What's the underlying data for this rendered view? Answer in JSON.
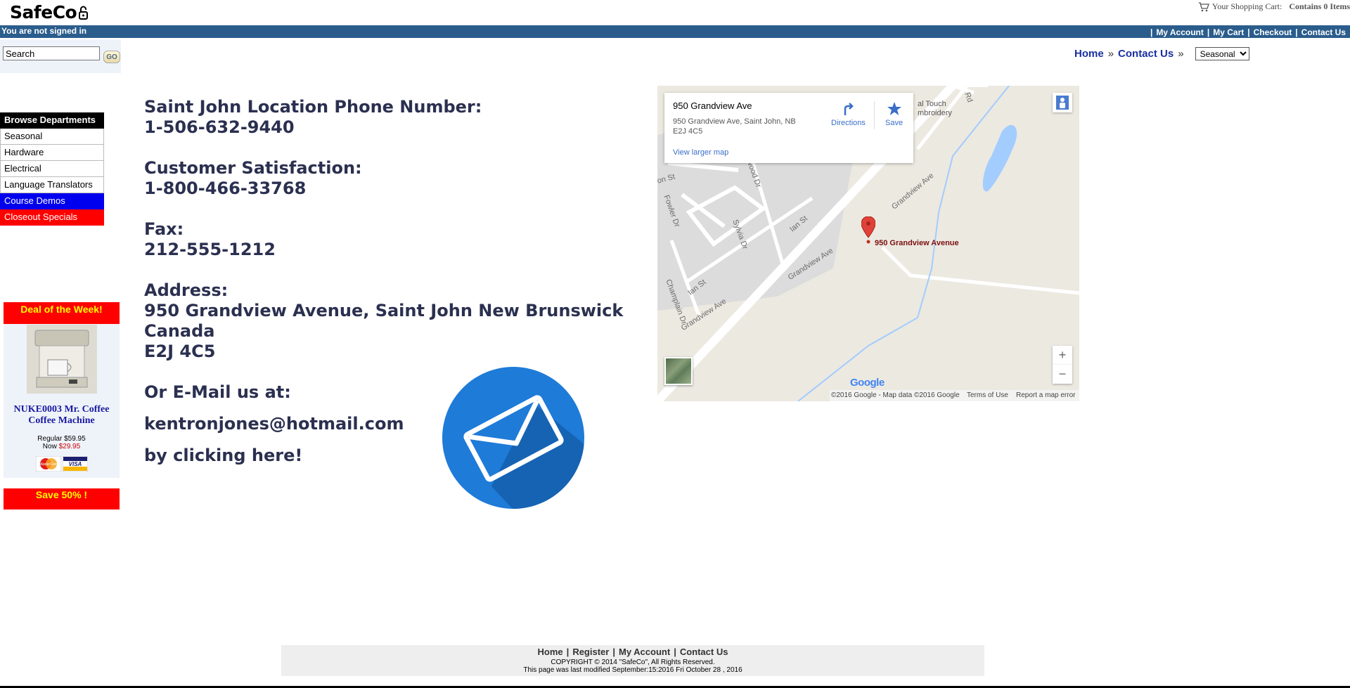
{
  "header": {
    "logo_text": "SafeCo",
    "cart_label": "Your Shopping Cart:",
    "cart_count": "Contains 0 Items",
    "signin_status": "You are not signed in",
    "links": [
      "My Account",
      "My Cart",
      "Checkout",
      "Contact Us"
    ]
  },
  "search": {
    "value": "Search",
    "go_label": "GO"
  },
  "breadcrumb": {
    "home": "Home",
    "current": "Contact Us",
    "separator": "»",
    "select_value": "Seasonal"
  },
  "departments": {
    "header": "Browse Departments",
    "items": [
      "Seasonal",
      "Hardware",
      "Electrical",
      "Language Translators"
    ],
    "course_demos": "Course Demos",
    "closeout": "Closeout Specials"
  },
  "deal": {
    "title": "Deal of the Week!",
    "product_line1": "NUKE0003 Mr. Coffee",
    "product_line2": "Coffee Machine",
    "regular": "Regular $59.95",
    "now_label": "Now",
    "now_price": "$29.95",
    "save": "Save 50% !",
    "card1": "MasterCard",
    "card2": "VISA"
  },
  "contact": {
    "phone_label": "Saint John Location Phone Number:",
    "phone": "1-506-632-9440",
    "satisfaction_label": "Customer Satisfaction:",
    "satisfaction_phone": "1-800-466-33768",
    "fax_label": "Fax:",
    "fax": "212-555-1212",
    "address_label": "Address:",
    "address_line1": "950 Grandview Avenue, Saint John New Brunswick",
    "address_line2": "Canada",
    "address_line3": "E2J 4C5",
    "email_label": "Or E-Mail us at:",
    "email": "kentronjones@hotmail.com",
    "click_text": "by clicking here!"
  },
  "map": {
    "place_name": "950 Grandview Ave",
    "place_address": "950 Grandview Ave, Saint John, NB E2J 4C5",
    "directions": "Directions",
    "save": "Save",
    "view_larger": "View larger map",
    "pin_label": "950 Grandview Avenue",
    "streets": [
      "Grandview Ave",
      "Grandview Ave",
      "Grandview Ave",
      "Ian St",
      "Ian St",
      "Sylvia Dr",
      "Fowler Dr",
      "Champlain Dr",
      "on St",
      "wood Dr",
      "Rd",
      "al Touch",
      "mbroidery"
    ],
    "zoom_in": "+",
    "zoom_out": "−",
    "google": "Google",
    "copyright": "©2016 Google - Map data ©2016 Google",
    "terms": "Terms of Use",
    "report": "Report a map error",
    "colors": {
      "road": "#ffffff",
      "land": "#ece9e1",
      "water": "#a3ccff",
      "urban": "#dcdcdc",
      "pin": "#e0413a"
    }
  },
  "footer": {
    "links": [
      "Home",
      "Register",
      "My Account",
      "Contact Us"
    ],
    "copyright": "COPYRIGHT © 2014 \"SafeCo\", All Rights Reserved.",
    "modified": "This page was last modified September:15:2016 Fri October 28 , 2016"
  }
}
